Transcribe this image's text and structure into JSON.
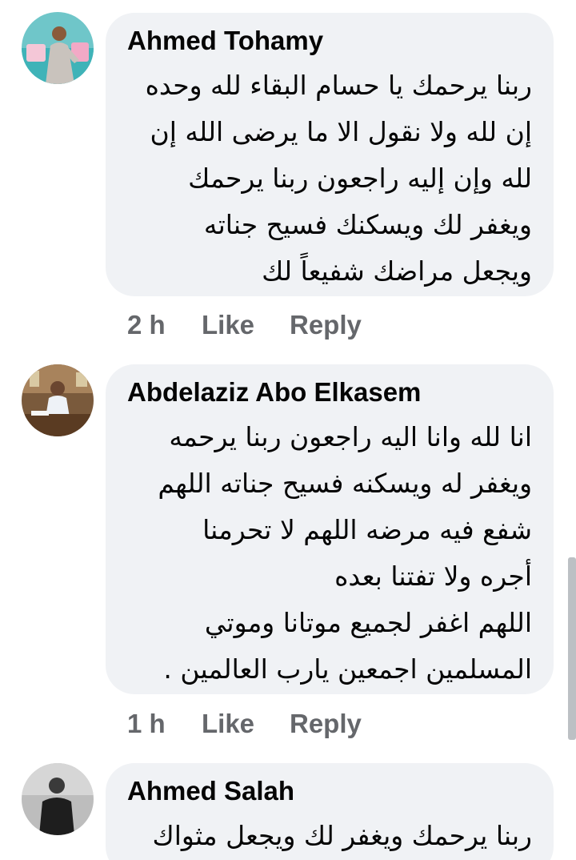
{
  "comments": [
    {
      "author": "Ahmed Tohamy",
      "avatar_icon": "profile-photo",
      "lines": [
        "ربنا يرحمك يا حسام البقاء لله وحده",
        "إن لله ولا نقول الا ما يرضى الله إن",
        "لله وإن إليه راجعون ربنا يرحمك",
        "ويغفر لك ويسكنك فسيح جناته",
        "ويجعل مراضك شفيعاً لك"
      ],
      "time": "2 h",
      "like_label": "Like",
      "reply_label": "Reply"
    },
    {
      "author": "Abdelaziz Abo Elkasem",
      "avatar_icon": "profile-photo",
      "lines": [
        "انا لله وانا اليه راجعون ربنا يرحمه",
        "ويغفر له ويسكنه فسيح جناته  اللهم",
        "شفع فيه مرضه  اللهم لا تحرمنا",
        "أجره ولا تفتنا بعده",
        "اللهم اغفر لجميع موتانا وموتي",
        "المسلمين اجمعين يارب العالمين ."
      ],
      "time": "1 h",
      "like_label": "Like",
      "reply_label": "Reply"
    },
    {
      "author": "Ahmed Salah",
      "avatar_icon": "profile-photo",
      "lines": [
        "ربنا يرحمك ويغفر لك ويجعل مثواك"
      ]
    }
  ],
  "colors": {
    "bubble_bg": "#f0f2f5",
    "meta_text": "#65676b",
    "primary_text": "#050505"
  }
}
